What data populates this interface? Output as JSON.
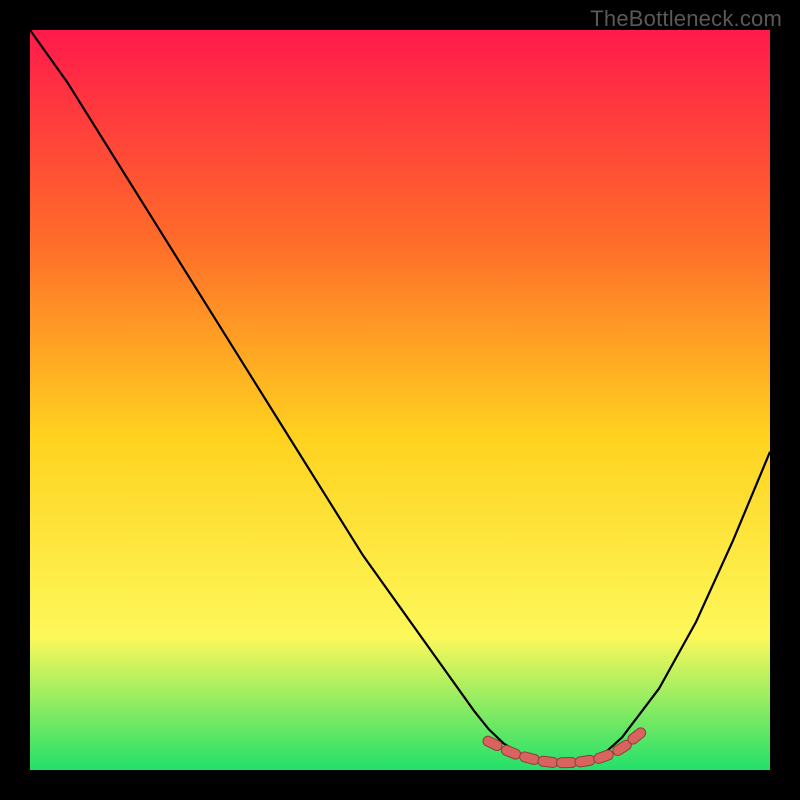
{
  "watermark": "TheBottleneck.com",
  "colors": {
    "bg": "#000000",
    "gradient_top": "#ff1a4b",
    "gradient_mid1": "#ff6a2a",
    "gradient_mid2": "#ffd21f",
    "gradient_mid3": "#fdf85a",
    "gradient_bottom": "#22e06a",
    "curve": "#000000",
    "marker_fill": "#d9635f",
    "marker_stroke": "#8f3e3c"
  },
  "chart_data": {
    "type": "line",
    "title": "",
    "xlabel": "",
    "ylabel": "",
    "xlim": [
      0,
      100
    ],
    "ylim": [
      0,
      100
    ],
    "grid": false,
    "legend": false,
    "series": [
      {
        "name": "bottleneck-curve",
        "x": [
          0,
          5,
          10,
          15,
          20,
          25,
          30,
          35,
          40,
          45,
          50,
          55,
          60,
          62,
          64,
          66,
          68,
          70,
          72,
          74,
          76,
          78,
          80,
          85,
          90,
          95,
          100
        ],
        "y": [
          100,
          93,
          85,
          77,
          69,
          61,
          53,
          45,
          37,
          29,
          22,
          15,
          8,
          5.5,
          3.6,
          2.3,
          1.5,
          1.1,
          1.0,
          1.1,
          1.6,
          2.6,
          4.4,
          11,
          20,
          31,
          43
        ]
      }
    ],
    "markers": {
      "name": "valley-markers",
      "x": [
        62.5,
        65,
        67.5,
        70,
        72.5,
        75,
        77.5,
        80,
        82
      ],
      "y": [
        3.6,
        2.4,
        1.6,
        1.1,
        1.0,
        1.2,
        1.8,
        3.0,
        4.6
      ]
    }
  }
}
